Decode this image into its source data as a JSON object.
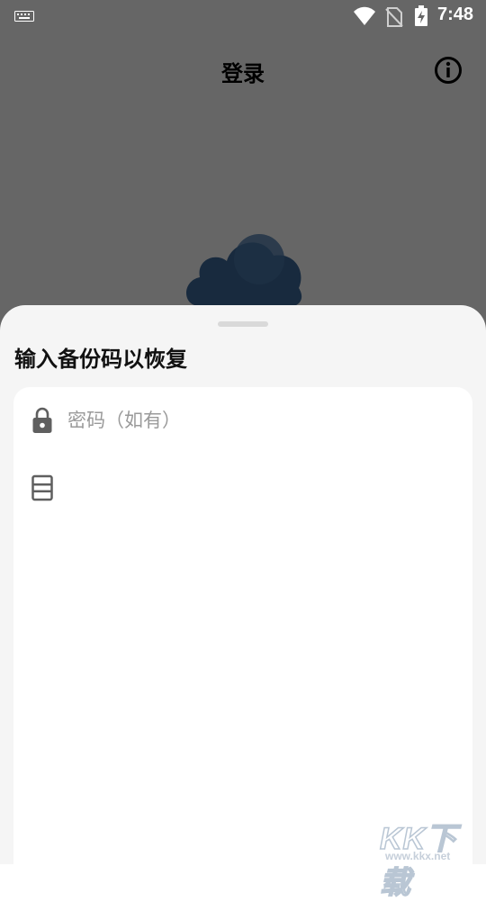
{
  "status_bar": {
    "time": "7:48",
    "icons": [
      "keyboard-icon",
      "wifi-icon",
      "no-sim-icon",
      "battery-charging-icon"
    ]
  },
  "header": {
    "title": "登录",
    "info_icon": "info-icon"
  },
  "background": {
    "logo_icon": "cloud-logo-icon",
    "cloud_color": "#3e6a9b"
  },
  "sheet": {
    "title": "输入备份码以恢复",
    "password_field": {
      "placeholder": "密码（如有）",
      "value": "",
      "icon": "lock-icon"
    },
    "backup_code_field": {
      "placeholder": "",
      "value": "",
      "icon": "storage-icon"
    }
  },
  "watermark": {
    "logo": "KK下载",
    "url": "www.kkx.net"
  },
  "colors": {
    "scrim": "#666666",
    "sheet_bg": "#f5f5f5",
    "card_bg": "#ffffff",
    "icon_gray": "#5f5f5f"
  }
}
